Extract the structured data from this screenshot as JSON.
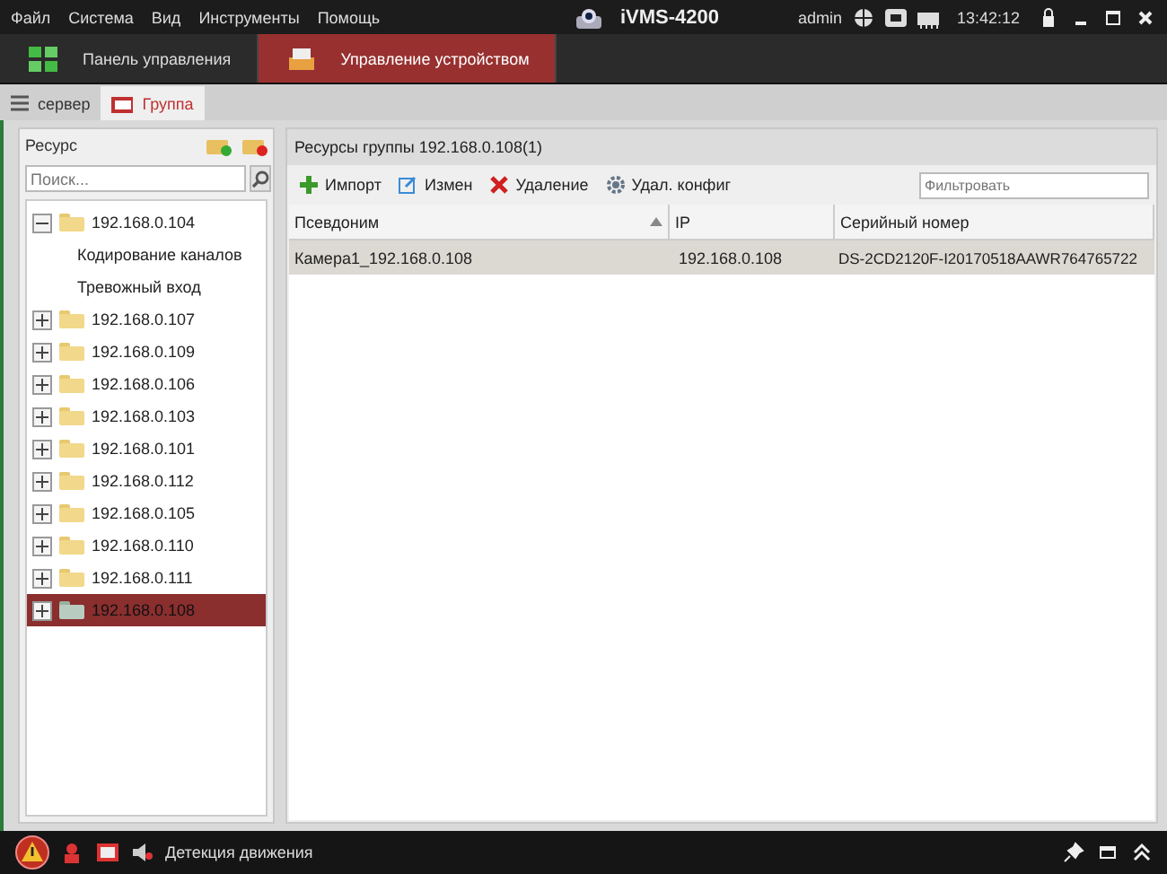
{
  "menu": [
    "Файл",
    "Система",
    "Вид",
    "Инструменты",
    "Помощь"
  ],
  "app_title": "iVMS-4200",
  "user": "admin",
  "clock": "13:42:12",
  "main_tabs": [
    {
      "label": "Панель управления",
      "selected": false,
      "kind": "grid"
    },
    {
      "label": "Управление устройством",
      "selected": true,
      "kind": "device"
    }
  ],
  "sub_tabs": [
    {
      "label": "сервер",
      "selected": false,
      "kind": "list"
    },
    {
      "label": "Группа",
      "selected": true,
      "kind": "folder"
    }
  ],
  "left_panel": {
    "title": "Ресурс",
    "search": {
      "placeholder": "Поиск..."
    },
    "tree": [
      {
        "label": "192.168.0.104",
        "expanded": true,
        "selected": false,
        "children": [
          {
            "label": "Кодирование каналов"
          },
          {
            "label": "Тревожный вход"
          }
        ]
      },
      {
        "label": "192.168.0.107",
        "expanded": false,
        "selected": false
      },
      {
        "label": "192.168.0.109",
        "expanded": false,
        "selected": false
      },
      {
        "label": "192.168.0.106",
        "expanded": false,
        "selected": false
      },
      {
        "label": "192.168.0.103",
        "expanded": false,
        "selected": false
      },
      {
        "label": "192.168.0.101",
        "expanded": false,
        "selected": false
      },
      {
        "label": "192.168.0.112",
        "expanded": false,
        "selected": false
      },
      {
        "label": "192.168.0.105",
        "expanded": false,
        "selected": false
      },
      {
        "label": "192.168.0.110",
        "expanded": false,
        "selected": false
      },
      {
        "label": "192.168.0.111",
        "expanded": false,
        "selected": false
      },
      {
        "label": "192.168.0.108",
        "expanded": false,
        "selected": true
      }
    ]
  },
  "right_panel": {
    "title": "Ресурсы группы 192.168.0.108(1)",
    "toolbar": [
      {
        "label": "Импорт",
        "kind": "add"
      },
      {
        "label": "Измен",
        "kind": "edit"
      },
      {
        "label": "Удаление",
        "kind": "delete"
      },
      {
        "label": "Удал. конфиг",
        "kind": "config"
      }
    ],
    "filter": {
      "placeholder": "Фильтровать"
    },
    "table": {
      "columns": [
        "Псевдоним",
        "IP",
        "Серийный номер"
      ],
      "rows": [
        {
          "cells": [
            "Камера1_192.168.0.108",
            "192.168.0.108",
            "DS-2CD2120F-I20170518AAWR764765722"
          ],
          "selected": true
        }
      ]
    }
  },
  "status_bar": {
    "label": "Детекция движения"
  }
}
